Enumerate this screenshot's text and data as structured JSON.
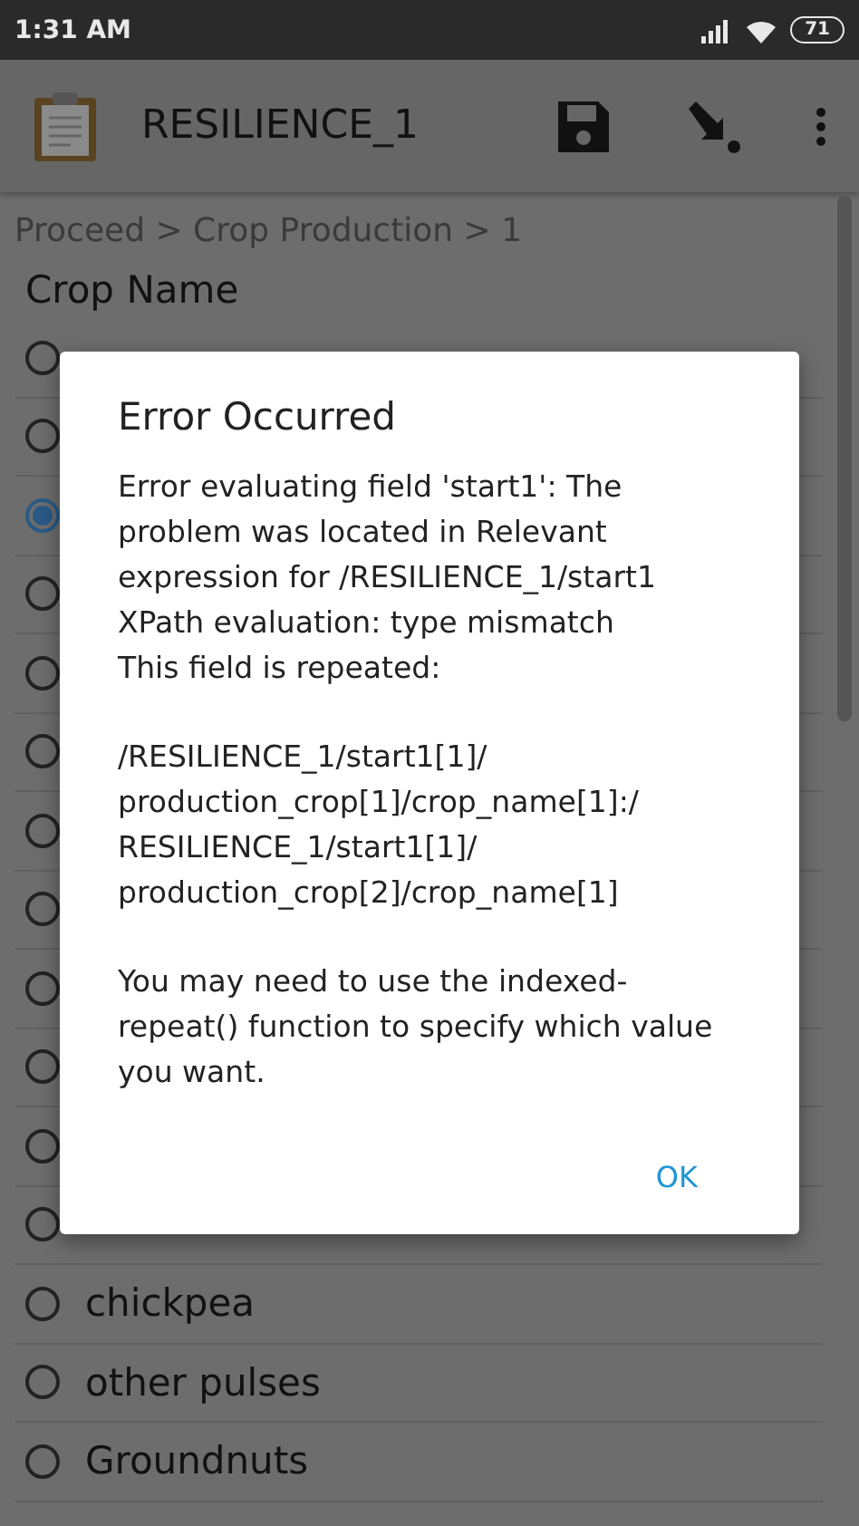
{
  "status_bar": {
    "time": "1:31 AM",
    "battery": "71"
  },
  "app_bar": {
    "title": "RESILIENCE_1"
  },
  "breadcrumb": "Proceed > Crop Production > 1",
  "question": {
    "label": "Crop Name",
    "options": [
      {
        "selected": false
      },
      {
        "selected": false
      },
      {
        "selected": true
      },
      {
        "selected": false
      },
      {
        "selected": false
      },
      {
        "selected": false
      },
      {
        "selected": false
      },
      {
        "selected": false
      },
      {
        "selected": false
      },
      {
        "selected": false
      },
      {
        "selected": false
      },
      {
        "selected": false
      },
      {
        "label": "chickpea",
        "selected": false
      },
      {
        "label": "other pulses",
        "selected": false
      },
      {
        "label": "Groundnuts",
        "selected": false
      }
    ]
  },
  "dialog": {
    "title": "Error Occurred",
    "paragraphs": [
      "Error evaluating field 'start1': The problem was located in Relevant expression for /RESILIENCE_1/start1\nXPath evaluation: type mismatch\nThis field is repeated:",
      "/RESILIENCE_1/start1[1]/\nproduction_crop[1]/crop_name[1]:/\nRESILIENCE_1/start1[1]/\nproduction_crop[2]/crop_name[1]",
      "You may need to use the indexed-repeat() function to specify which value you want."
    ],
    "button": "OK"
  }
}
